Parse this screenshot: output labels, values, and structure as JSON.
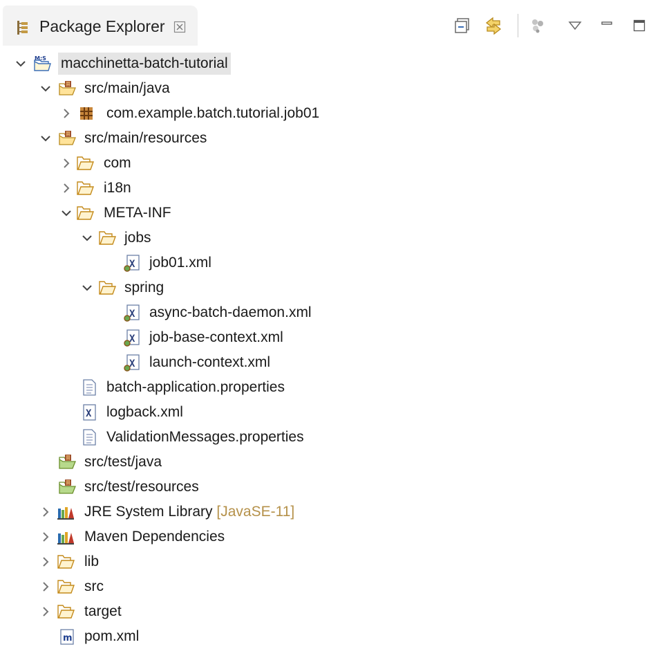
{
  "view": {
    "title": "Package Explorer",
    "toolbar": [
      {
        "name": "collapse-all-icon",
        "tooltip": "Collapse All"
      },
      {
        "name": "link-with-editor-icon",
        "tooltip": "Link with Editor"
      },
      {
        "name": "focus-active-task-icon",
        "tooltip": "Focus on Active Task"
      },
      {
        "name": "view-menu-icon",
        "tooltip": "View Menu"
      },
      {
        "name": "minimize-icon",
        "tooltip": "Minimize"
      },
      {
        "name": "maximize-icon",
        "tooltip": "Maximize"
      }
    ]
  },
  "tree": {
    "items": [
      {
        "label": "macchinetta-batch-tutorial",
        "icon": "maven-project-icon",
        "state": "expanded",
        "selected": true
      },
      {
        "label": "src/main/java",
        "icon": "source-folder-icon",
        "state": "expanded"
      },
      {
        "label": "com.example.batch.tutorial.job01",
        "icon": "package-icon",
        "state": "collapsed"
      },
      {
        "label": "src/main/resources",
        "icon": "source-folder-icon",
        "state": "expanded"
      },
      {
        "label": "com",
        "icon": "folder-icon",
        "state": "collapsed"
      },
      {
        "label": "i18n",
        "icon": "folder-icon",
        "state": "collapsed"
      },
      {
        "label": "META-INF",
        "icon": "folder-icon",
        "state": "expanded"
      },
      {
        "label": "jobs",
        "icon": "folder-icon",
        "state": "expanded"
      },
      {
        "label": "job01.xml",
        "icon": "spring-xml-file-icon",
        "state": "leaf"
      },
      {
        "label": "spring",
        "icon": "folder-icon",
        "state": "expanded"
      },
      {
        "label": "async-batch-daemon.xml",
        "icon": "spring-xml-file-icon",
        "state": "leaf"
      },
      {
        "label": "job-base-context.xml",
        "icon": "spring-xml-file-icon",
        "state": "leaf"
      },
      {
        "label": "launch-context.xml",
        "icon": "spring-xml-file-icon",
        "state": "leaf"
      },
      {
        "label": "batch-application.properties",
        "icon": "properties-file-icon",
        "state": "leaf"
      },
      {
        "label": "logback.xml",
        "icon": "xml-file-icon",
        "state": "leaf"
      },
      {
        "label": "ValidationMessages.properties",
        "icon": "properties-file-icon",
        "state": "leaf"
      },
      {
        "label": "src/test/java",
        "icon": "source-folder-icon",
        "state": "leaf"
      },
      {
        "label": "src/test/resources",
        "icon": "source-folder-icon",
        "state": "leaf"
      },
      {
        "label": "JRE System Library",
        "decoration": " [JavaSE-11]",
        "icon": "library-icon",
        "state": "collapsed"
      },
      {
        "label": "Maven Dependencies",
        "icon": "library-icon",
        "state": "collapsed"
      },
      {
        "label": "lib",
        "icon": "folder-icon",
        "state": "collapsed"
      },
      {
        "label": "src",
        "icon": "folder-icon",
        "state": "collapsed"
      },
      {
        "label": "target",
        "icon": "folder-icon",
        "state": "collapsed"
      },
      {
        "label": "pom.xml",
        "icon": "maven-pom-icon",
        "state": "leaf"
      }
    ]
  }
}
